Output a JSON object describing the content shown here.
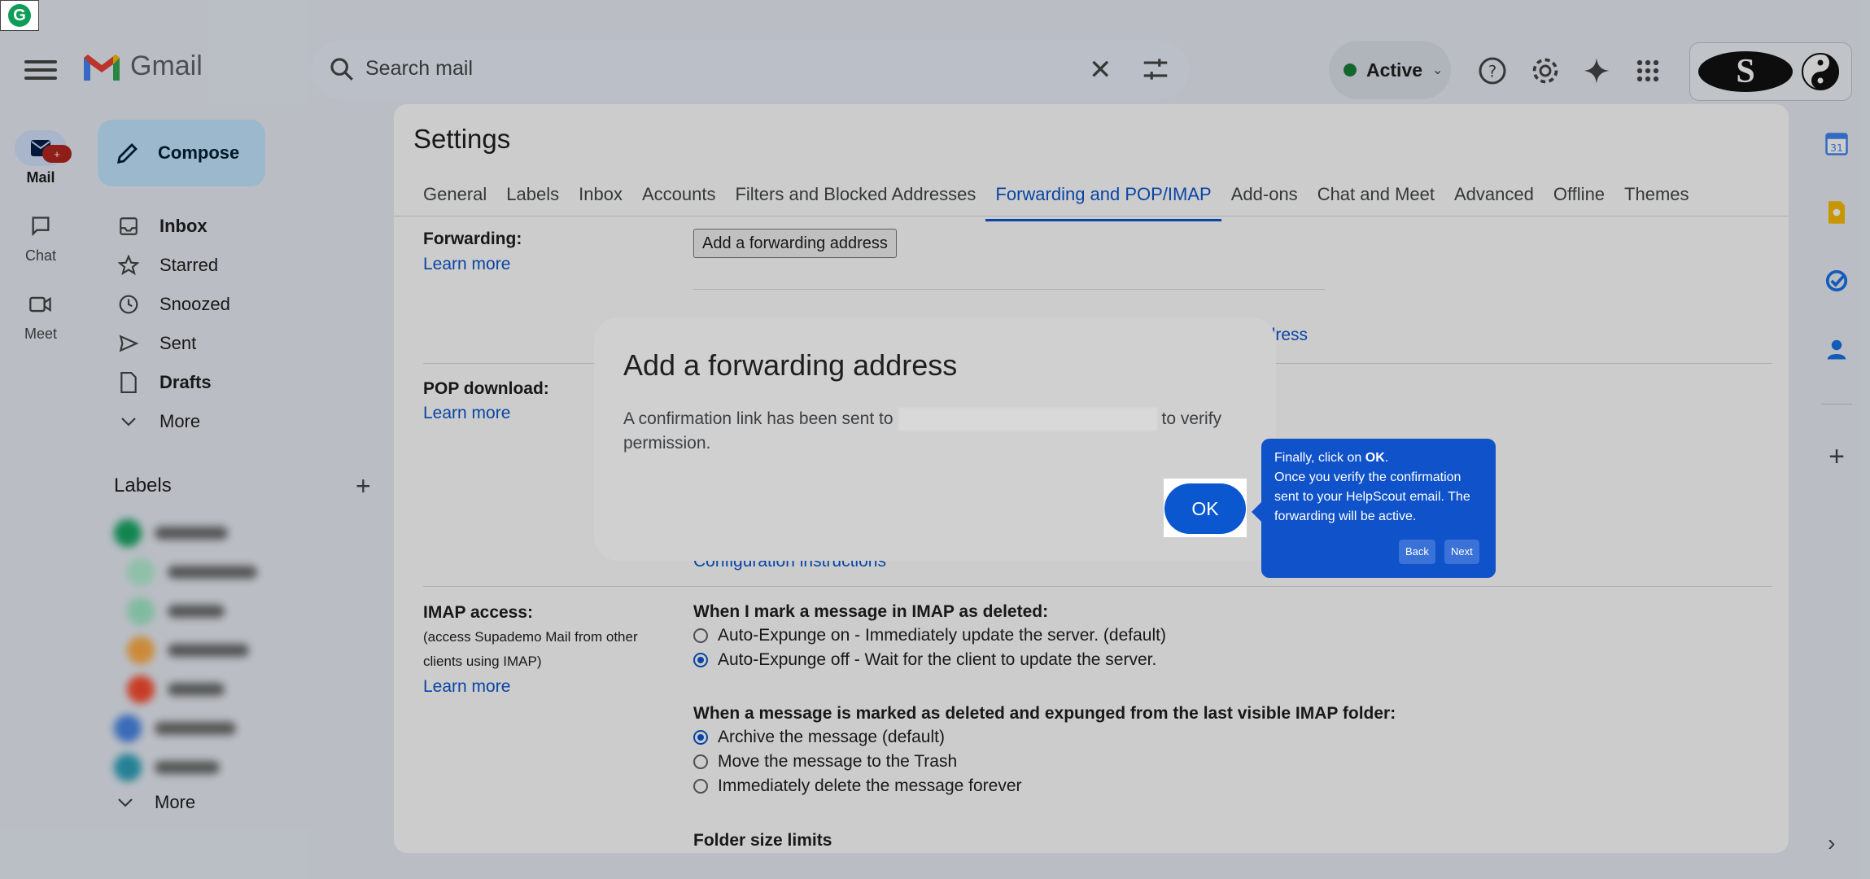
{
  "header": {
    "app_name": "Gmail",
    "search_placeholder": "Search mail",
    "status_label": "Active",
    "status_color": "#188038",
    "account_initial": "S"
  },
  "rail": {
    "mail_label": "Mail",
    "mail_badge": "+",
    "chat_label": "Chat",
    "meet_label": "Meet"
  },
  "sidebar": {
    "compose_label": "Compose",
    "items": [
      {
        "label": "Inbox",
        "icon": "inbox-icon",
        "bold": true
      },
      {
        "label": "Starred",
        "icon": "star-icon",
        "bold": false
      },
      {
        "label": "Snoozed",
        "icon": "clock-icon",
        "bold": false
      },
      {
        "label": "Sent",
        "icon": "send-icon",
        "bold": false
      },
      {
        "label": "Drafts",
        "icon": "draft-icon",
        "bold": true
      },
      {
        "label": "More",
        "icon": "chevron-down-icon",
        "bold": false
      }
    ],
    "labels_heading": "Labels",
    "labels_more": "More",
    "label_colors": [
      "#16a765",
      "#b3efd3",
      "#a0eac9",
      "#ffad47",
      "#fb4c2f",
      "#4986e7",
      "#2da2bb"
    ]
  },
  "settings": {
    "title": "Settings",
    "tabs": [
      "General",
      "Labels",
      "Inbox",
      "Accounts",
      "Filters and Blocked Addresses",
      "Forwarding and POP/IMAP",
      "Add-ons",
      "Chat and Meet",
      "Advanced",
      "Offline",
      "Themes"
    ],
    "selected_tab": "Forwarding and POP/IMAP",
    "forwarding": {
      "heading": "Forwarding:",
      "learn_more": "Learn more",
      "button": "Add a forwarding address",
      "partial_link": "ddress"
    },
    "pop": {
      "heading": "POP download:",
      "learn_more": "Learn more",
      "config_link": "Configuration instructions"
    },
    "imap": {
      "heading": "IMAP access:",
      "desc_line1": "(access Supademo Mail from other",
      "desc_line2": "clients using IMAP)",
      "learn_more": "Learn more",
      "deleted_heading": "When I mark a message in IMAP as deleted:",
      "deleted_opt1": "Auto-Expunge on - Immediately update the server. (default)",
      "deleted_opt2": "Auto-Expunge off - Wait for the client to update the server.",
      "expunged_heading": "When a message is marked as deleted and expunged from the last visible IMAP folder:",
      "expunged_opt1": "Archive the message (default)",
      "expunged_opt2": "Move the message to the Trash",
      "expunged_opt3": "Immediately delete the message forever",
      "folder_heading": "Folder size limits"
    }
  },
  "dialog": {
    "title": "Add a forwarding address",
    "body_before": "A confirmation link has been sent to",
    "body_after": "to verify permission.",
    "ok_label": "OK"
  },
  "tooltip": {
    "line1_prefix": "Finally, click on",
    "line1_bold": "OK",
    "line1_suffix": ".",
    "text": "Once you verify the confirmation sent to your HelpScout email. The forwarding will be active.",
    "back_label": "Back",
    "next_label": "Next"
  }
}
